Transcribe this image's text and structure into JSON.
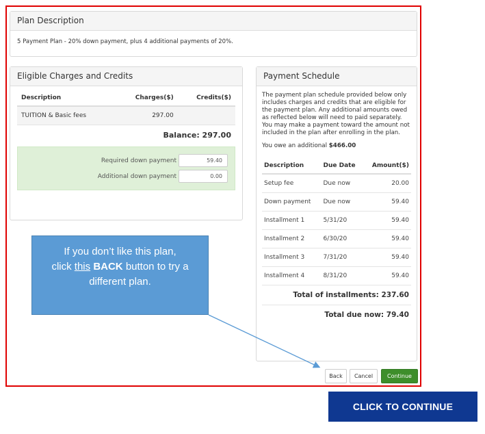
{
  "plan_description": {
    "title": "Plan Description",
    "text": "5 Payment Plan - 20% down payment, plus 4 additional payments of 20%."
  },
  "eligible": {
    "title": "Eligible Charges and Credits",
    "headers": {
      "description": "Description",
      "charges": "Charges($)",
      "credits": "Credits($)"
    },
    "rows": [
      {
        "description": "TUITION & Basic fees",
        "charges": "297.00",
        "credits": ""
      }
    ],
    "balance": "Balance: 297.00",
    "required_label": "Required down payment",
    "required_value": "59.40",
    "additional_label": "Additional down payment",
    "additional_value": "0.00"
  },
  "schedule": {
    "title": "Payment Schedule",
    "note": "The payment plan schedule provided below only includes charges and credits that are eligible for the payment plan. Any additional amounts owed as reflected below will need to paid separately. You may make a payment toward the amount not included in the plan after enrolling in the plan.",
    "owe_prefix": "You owe an additional",
    "owe_amount": "$466.00",
    "headers": {
      "description": "Description",
      "due_date": "Due Date",
      "amount": "Amount($)"
    },
    "rows": [
      {
        "description": "Setup fee",
        "due_date": "Due now",
        "amount": "20.00"
      },
      {
        "description": "Down payment",
        "due_date": "Due now",
        "amount": "59.40"
      },
      {
        "description": "Installment 1",
        "due_date": "5/31/20",
        "amount": "59.40"
      },
      {
        "description": "Installment 2",
        "due_date": "6/30/20",
        "amount": "59.40"
      },
      {
        "description": "Installment 3",
        "due_date": "7/31/20",
        "amount": "59.40"
      },
      {
        "description": "Installment 4",
        "due_date": "8/31/20",
        "amount": "59.40"
      }
    ],
    "total_installments": "Total of installments: 237.60",
    "total_due_now": "Total due now: 79.40"
  },
  "buttons": {
    "back": "Back",
    "cancel": "Cancel",
    "continue": "Continue"
  },
  "callout": {
    "line1": "If you don’t like this plan,",
    "line2_pre": "click ",
    "line2_this": "this",
    "line2_back": "BACK",
    "line2_post": " button to try a",
    "line3": "different plan."
  },
  "banner": {
    "label": "CLICK TO CONTINUE"
  },
  "colors": {
    "frame": "#e00000",
    "callout": "#5b9bd5",
    "banner": "#0f3891",
    "continue": "#3e8e2b",
    "down_box": "#dff0d8"
  }
}
